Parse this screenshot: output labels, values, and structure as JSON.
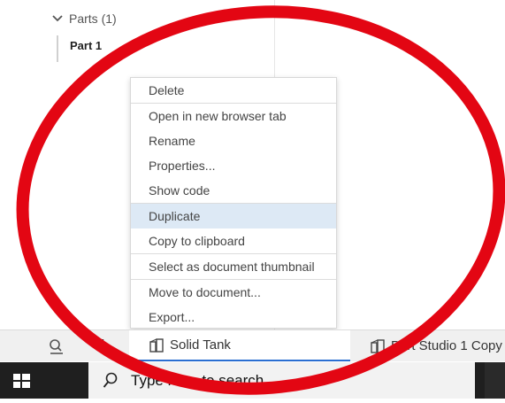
{
  "panel": {
    "parts_header": "Parts (1)",
    "part_item": "Part 1"
  },
  "context_menu": {
    "items": [
      {
        "label": "Delete"
      },
      {
        "label": "Open in new browser tab"
      },
      {
        "label": "Rename"
      },
      {
        "label": "Properties..."
      },
      {
        "label": "Show code"
      },
      {
        "label": "Duplicate"
      },
      {
        "label": "Copy to clipboard"
      },
      {
        "label": "Select as document thumbnail"
      },
      {
        "label": "Move to document..."
      },
      {
        "label": "Export..."
      }
    ],
    "highlighted": "Duplicate"
  },
  "tabs": {
    "active": {
      "label": "Solid Tank",
      "icon": "part-studio-icon"
    },
    "other": {
      "label": "Part Studio 1 Copy",
      "icon": "part-studio-icon"
    }
  },
  "taskbar": {
    "search_placeholder": "Type here to search"
  },
  "colors": {
    "annotation": "#e30613",
    "highlight": "#dde9f5",
    "active_tab_underline": "#2a6ed1"
  }
}
